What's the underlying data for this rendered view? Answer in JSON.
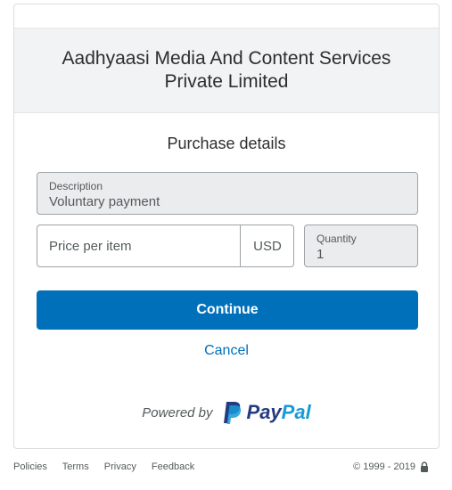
{
  "merchant": {
    "name": "Aadhyaasi Media And Content Services Private Limited"
  },
  "purchase": {
    "title": "Purchase details",
    "description": {
      "label": "Description",
      "value": "Voluntary payment"
    },
    "price": {
      "placeholder": "Price per item",
      "currency": "USD"
    },
    "quantity": {
      "label": "Quantity",
      "value": "1"
    }
  },
  "actions": {
    "continue": "Continue",
    "cancel": "Cancel"
  },
  "branding": {
    "powered_by": "Powered by",
    "pay": "Pay",
    "pal": "Pal"
  },
  "footer": {
    "links": [
      "Policies",
      "Terms",
      "Privacy",
      "Feedback"
    ],
    "copyright": "© 1999 - 2019"
  },
  "colors": {
    "accent": "#0070ba",
    "paypal_dark": "#253b80",
    "paypal_light": "#179bd7"
  },
  "icons": {
    "brand": "paypal-logo-icon",
    "lock": "lock-icon"
  }
}
